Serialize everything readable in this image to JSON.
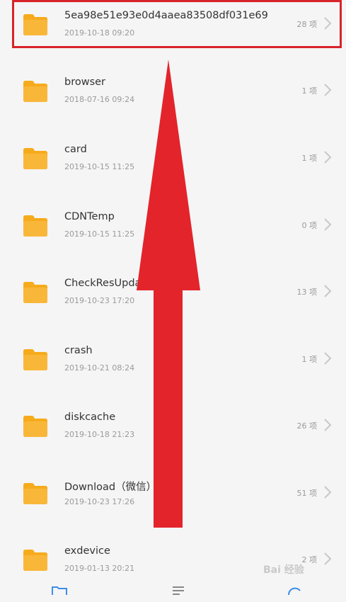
{
  "colors": {
    "folder": "#f6ab1c",
    "highlight_box": "#d9232a",
    "arrow": "#e3242b",
    "chevron": "#c8c8c8"
  },
  "files": [
    {
      "name": "5ea98e51e93e0d4aaea83508df031e69",
      "date": "2019-10-18 09:20",
      "count": "28 项"
    },
    {
      "name": "browser",
      "date": "2018-07-16 09:24",
      "count": "1 项"
    },
    {
      "name": "card",
      "date": "2019-10-15 11:25",
      "count": "1 项"
    },
    {
      "name": "CDNTemp",
      "date": "2019-10-15 11:25",
      "count": "0 项"
    },
    {
      "name": "CheckResUpdat",
      "date": "2019-10-23 17:20",
      "count": "13 项"
    },
    {
      "name": "crash",
      "date": "2019-10-21 08:24",
      "count": "1 项"
    },
    {
      "name": "diskcache",
      "date": "2019-10-18 21:23",
      "count": "26 项"
    },
    {
      "name": "Download（微信）",
      "date": "2019-10-23 17:26",
      "count": "51 项"
    },
    {
      "name": "exdevice",
      "date": "2019-01-13 20:21",
      "count": "2 项"
    }
  ],
  "watermark": "Bai 经验",
  "icons": {
    "folder": "folder-icon",
    "chevron": "chevron-right-icon",
    "tabs": [
      "folder-tab-icon",
      "list-tab-icon",
      "refresh-tab-icon"
    ]
  }
}
